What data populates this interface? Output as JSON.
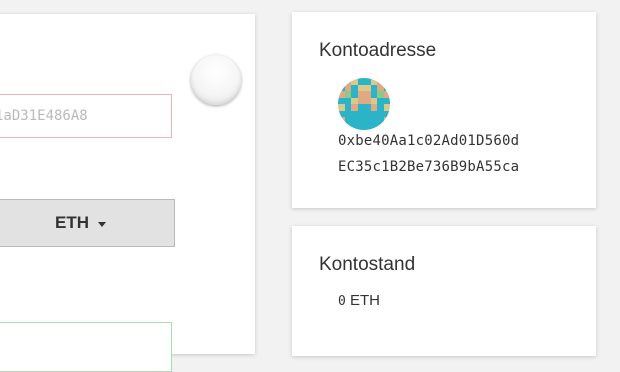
{
  "send_form": {
    "address_value": "1aD31E486A8",
    "currency_selected": "ETH",
    "amount_value": ""
  },
  "account": {
    "title": "Kontoadresse",
    "address_line1": "0xbe40Aa1c02Ad01D560d",
    "address_line2": "EC35c1B2Be736B9bA55ca",
    "avatar_colors": [
      "#2bb3c8",
      "#e0a986",
      "#8fc98a",
      "#d9c98b"
    ]
  },
  "balance": {
    "title": "Kontostand",
    "amount": "0",
    "unit": "ETH"
  }
}
